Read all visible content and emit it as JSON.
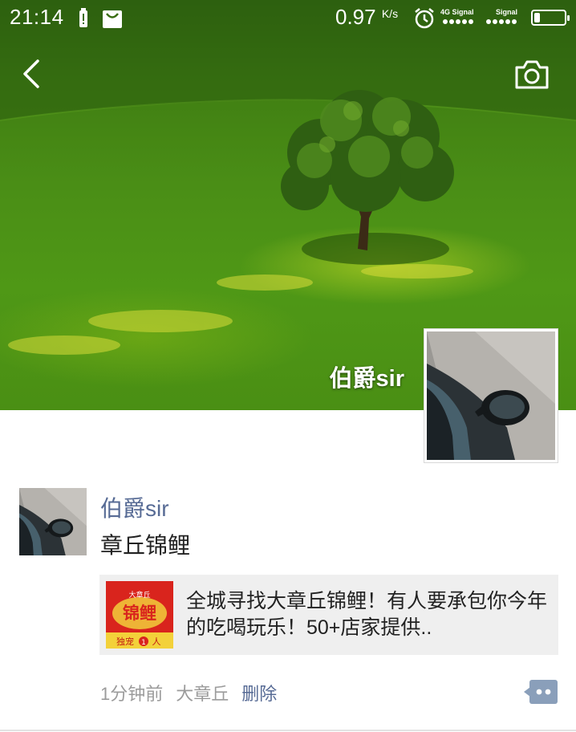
{
  "status_bar": {
    "time": "21:14",
    "net_speed": "0.97",
    "net_speed_unit": "K/s",
    "sim1_label": "4G Signal",
    "sim2_label": "Signal",
    "battery_level": 0.2,
    "icons": [
      "battery-alert-icon",
      "notification-bag-icon",
      "alarm-icon"
    ]
  },
  "nav": {
    "back_icon": "chevron-left-icon",
    "camera_icon": "camera-icon"
  },
  "profile": {
    "name": "伯爵sir",
    "avatar_icon": "car-side-mirror-photo"
  },
  "post": {
    "author": "伯爵sir",
    "text": "章丘锦鲤",
    "link": {
      "title": "全城寻找大章丘锦鲤！有人要承包你今年的吃喝玩乐！50+店家提供..",
      "thumb_top": "大章丘",
      "thumb_main": "锦鲤",
      "thumb_bottom": "独宠",
      "thumb_badge": "1",
      "thumb_bottom2": "人"
    },
    "time": "1分钟前",
    "location": "大章丘",
    "delete_label": "删除",
    "comment_icon": "comment-dots-icon"
  },
  "colors": {
    "link_blue": "#576b95",
    "meta_gray": "#9b9b9b",
    "card_bg": "#efefef"
  }
}
